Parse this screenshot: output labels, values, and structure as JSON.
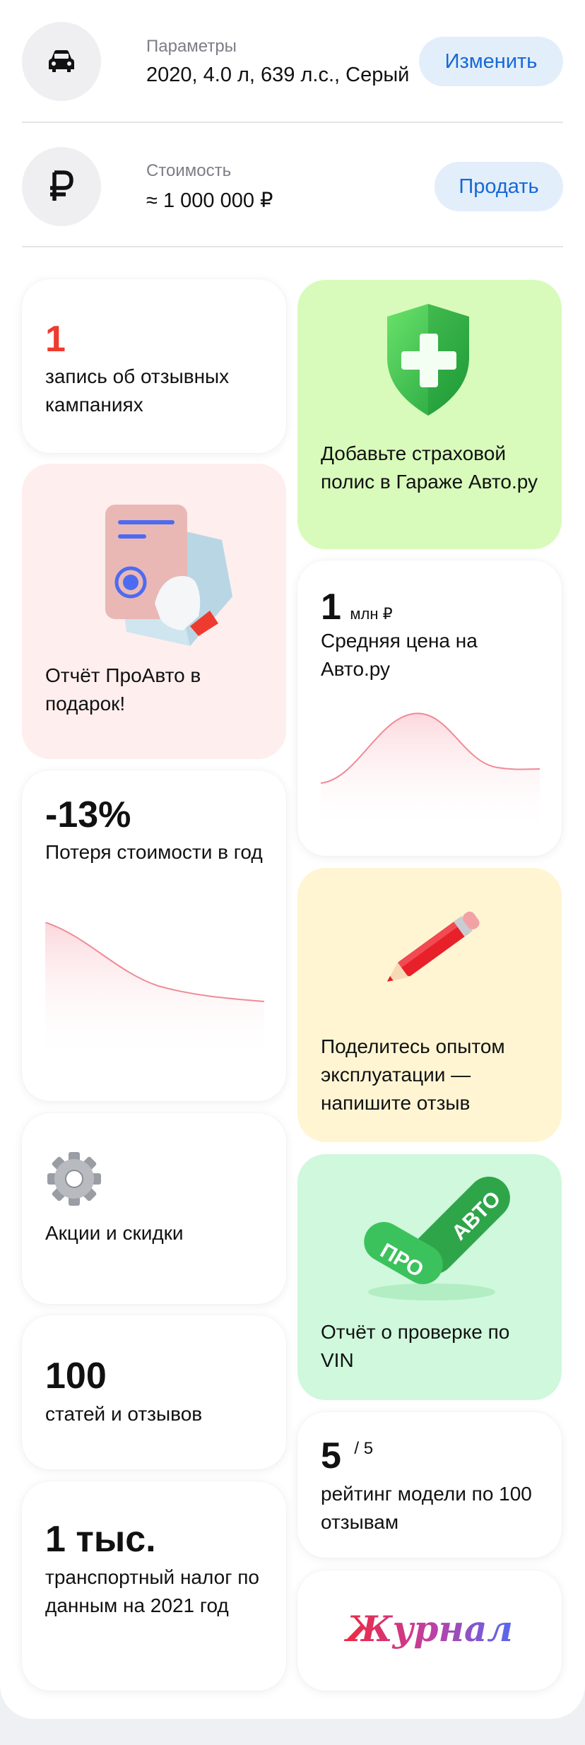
{
  "params_row": {
    "label": "Параметры",
    "value": "2020,  4.0 л, 639 л.с., Серый",
    "button": "Изменить",
    "icon": "car-icon"
  },
  "price_row": {
    "label": "Стоимость",
    "value": "≈ 1 000 000 ₽",
    "button": "Продать",
    "icon": "ruble-icon"
  },
  "cards": {
    "recall": {
      "number": "1",
      "text": "запись об отзывных кампаниях"
    },
    "insurance": {
      "text": "Добавьте страховой полис в Гараже Авто.ру",
      "icon": "shield-plus-icon"
    },
    "report": {
      "text": "Отчёт ПроАвто в подарок!",
      "icon": "document-hand-icon"
    },
    "avg_price": {
      "number": "1",
      "unit": "млн ₽",
      "text": "Средняя цена на Авто.ру"
    },
    "loss": {
      "number": "-13%",
      "text": "Потеря стоимости в год"
    },
    "review": {
      "text": "Поделитесь опытом эксплуатации — напишите отзыв",
      "icon": "pencil-icon"
    },
    "promo": {
      "text": "Акции и скидки",
      "icon": "gear-icon"
    },
    "vin": {
      "text": "Отчёт о проверке по VIN",
      "badge_left": "ПРО",
      "badge_right": "АВТО"
    },
    "articles": {
      "number": "100",
      "text": "статей и отзывов"
    },
    "rating": {
      "number": "5",
      "scale": "/ 5",
      "text": "рейтинг модели по 100 отзывам"
    },
    "tax": {
      "number": "1 тыс.",
      "text": "транспортный налог по данным на 2021 год"
    },
    "journal": {
      "logo_text": "Журнал"
    }
  },
  "colors": {
    "accent_blue": "#1569D6",
    "button_bg": "#E3EEFB",
    "recall_red": "#EE3B2F",
    "insurance_bg": "#D8FBBB",
    "report_bg": "#FFEEEE",
    "review_bg": "#FFF5D3",
    "vin_bg": "#CFF8DC",
    "chart_line": "#F08A96"
  }
}
